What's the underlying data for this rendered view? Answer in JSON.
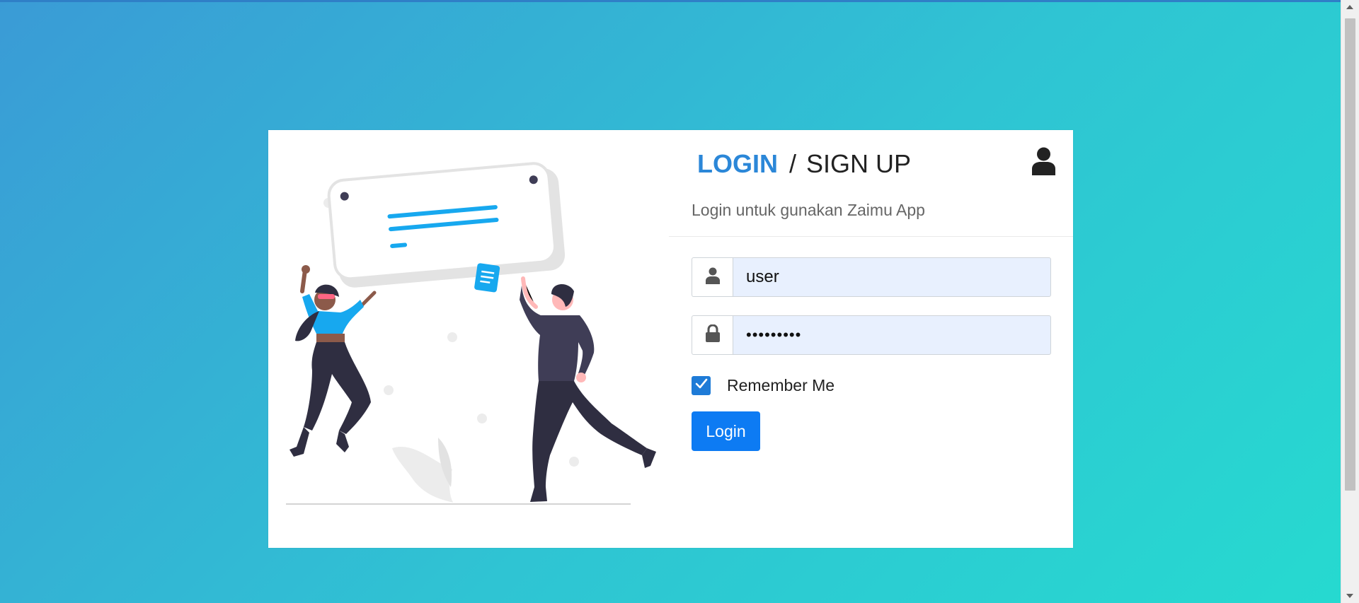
{
  "auth": {
    "login_tab": "LOGIN",
    "separator": "/",
    "signup_tab": "SIGN UP",
    "subtitle": "Login untuk gunakan Zaimu App"
  },
  "form": {
    "username_value": "user",
    "password_value": "•••••••••",
    "remember_label": "Remember Me",
    "remember_checked": true,
    "login_button": "Login"
  },
  "icons": {
    "account": "user-icon",
    "username_addon": "user-icon",
    "password_addon": "lock-icon",
    "checkbox": "check-icon"
  },
  "colors": {
    "accent": "#2b87d8",
    "button": "#0d7bf3",
    "autofill": "#e8f0fe",
    "figure_top": "#17a8ef"
  }
}
